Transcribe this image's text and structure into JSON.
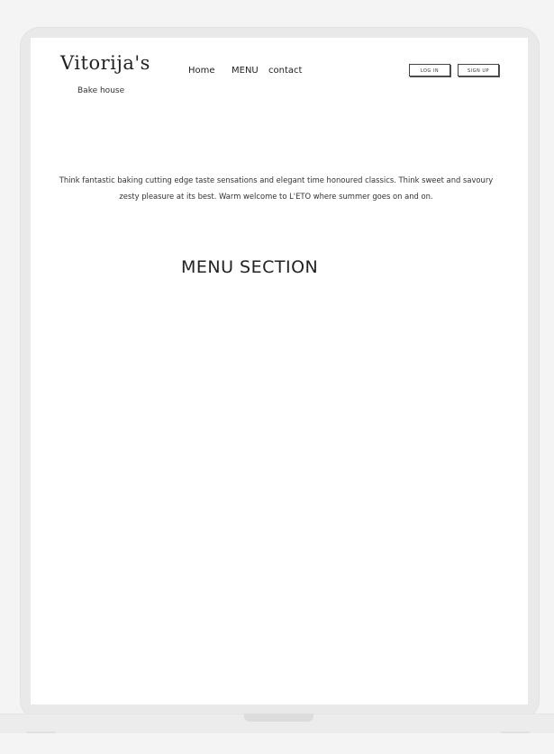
{
  "header": {
    "brand": "Vitorija's",
    "tagline": "Bake house",
    "nav": [
      "Home",
      "MENU",
      "contact"
    ],
    "login_label": "LOG IN",
    "signup_label": "SIGN UP"
  },
  "main": {
    "intro": "Think fantastic baking cutting edge taste sensations and elegant time honoured classics. Think sweet and savoury zesty pleasure at its best. Warm welcome to L'ETO where summer goes on and on.",
    "section_title": "MENU SECTION"
  }
}
